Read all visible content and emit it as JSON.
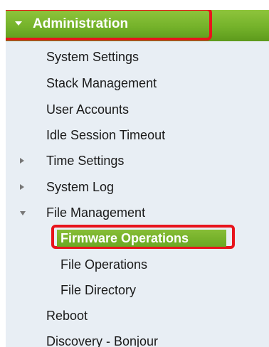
{
  "nav": {
    "header": {
      "label": "Administration"
    },
    "items": [
      {
        "label": "System Settings"
      },
      {
        "label": "Stack Management"
      },
      {
        "label": "User Accounts"
      },
      {
        "label": "Idle Session Timeout"
      },
      {
        "label": "Time Settings",
        "state": "collapsed"
      },
      {
        "label": "System Log",
        "state": "collapsed"
      },
      {
        "label": "File Management",
        "state": "expanded"
      },
      {
        "label": "Firmware Operations",
        "selected": true
      },
      {
        "label": "File Operations"
      },
      {
        "label": "File Directory"
      },
      {
        "label": "Reboot"
      },
      {
        "label": "Discovery - Bonjour"
      }
    ]
  },
  "colors": {
    "header_green": "#74b22a",
    "highlight_red": "#e8141c",
    "panel_bg": "#e8eef4"
  }
}
